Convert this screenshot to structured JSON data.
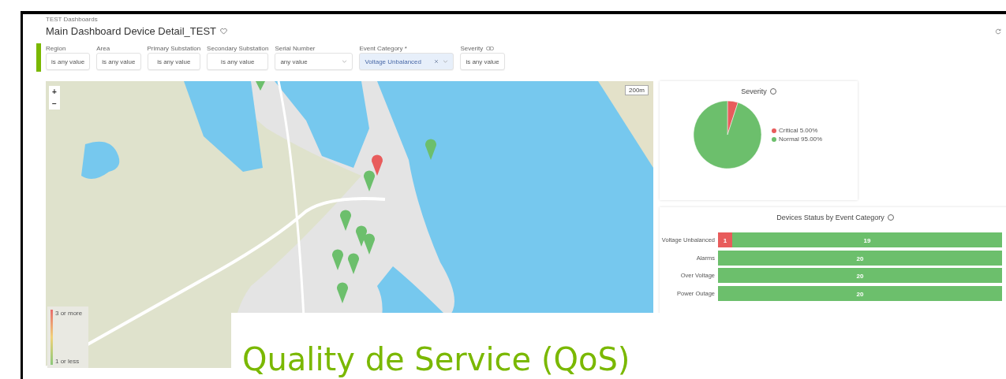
{
  "breadcrumb": "TEST Dashboards",
  "title": "Main Dashboard Device Detail_TEST",
  "filters": [
    {
      "label": "Region",
      "value": "is any value",
      "kind": "text"
    },
    {
      "label": "Area",
      "value": "is any value",
      "kind": "text"
    },
    {
      "label": "Primary Substation",
      "value": "is any value",
      "kind": "text"
    },
    {
      "label": "Secondary Substation",
      "value": "is any value",
      "kind": "text"
    },
    {
      "label": "Serial Number",
      "value": "any value",
      "kind": "select"
    },
    {
      "label": "Event Category *",
      "value": "Voltage Unbalanced",
      "kind": "chip"
    },
    {
      "label": "Severity",
      "value": "is any value",
      "kind": "linked"
    }
  ],
  "map": {
    "zoom_in": "+",
    "zoom_out": "−",
    "scale": "200m",
    "legend": [
      "3 or more",
      "1 or less"
    ]
  },
  "severity": {
    "title": "Severity",
    "chart_data": {
      "type": "pie",
      "categories": [
        "Critical 5.00%",
        "Normal 95.00%"
      ],
      "legend": "right",
      "colors": [
        "#e85c5c",
        "#6cbf6c"
      ],
      "series": [
        {
          "values": [
            5,
            95
          ]
        }
      ]
    }
  },
  "status": {
    "title": "Devices Status by Event Category",
    "chart_data": {
      "type": "bar",
      "orientation": "horizontal",
      "stacked": true,
      "categories": [
        "Voltage Unbalanced",
        "Alarms",
        "Over Voltage",
        "Power Outage"
      ],
      "series": [
        {
          "color": "#e85c5c",
          "values": [
            1,
            null,
            null,
            null
          ]
        },
        {
          "color": "#6cbf6c",
          "values": [
            19,
            20,
            20,
            20
          ]
        }
      ],
      "data_labels": true
    }
  },
  "banner": "Quality de Service (QoS)"
}
